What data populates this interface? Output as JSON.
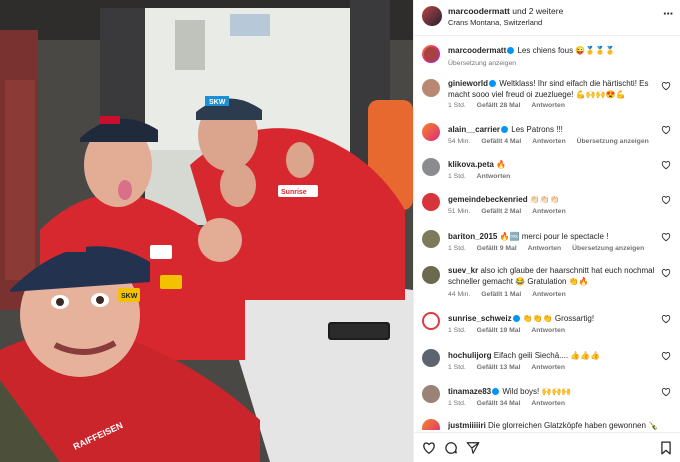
{
  "header": {
    "username": "marcoodermatt",
    "and_more": "und 2 weitere",
    "location": "Crans Montana, Switzerland"
  },
  "icons": {
    "more": "more-options-icon",
    "like": "heart-icon",
    "comment": "comment-icon",
    "share": "send-icon",
    "save": "bookmark-icon"
  },
  "caption": {
    "user": "marcoodermatt",
    "text": "Les chiens fous 😜🥇🥇🥇",
    "translate": "Übersetzung anzeigen"
  },
  "comments": [
    {
      "user": "ginieworld",
      "verified": true,
      "text": "Weltklass! Ihr sind eifach die härtischti! Es macht sooo viel freud oi zuezluege! 💪🙌🙌😍💪",
      "time": "1 Std.",
      "likes": "Gefällt 28 Mal",
      "reply": "Antworten",
      "translate": ""
    },
    {
      "user": "alain__carrier",
      "verified": true,
      "text": "Les Patrons !!!",
      "time": "54 Min.",
      "likes": "Gefällt 4 Mal",
      "reply": "Antworten",
      "translate": "Übersetzung anzeigen"
    },
    {
      "user": "klikova.peta",
      "verified": false,
      "text": "🔥",
      "time": "1 Std.",
      "likes": "",
      "reply": "Antworten",
      "translate": ""
    },
    {
      "user": "gemeindebeckenried",
      "verified": false,
      "text": "👏🏻👏🏻👏🏻",
      "time": "51 Min.",
      "likes": "Gefällt 2 Mal",
      "reply": "Antworten",
      "translate": ""
    },
    {
      "user": "bariton_2015",
      "verified": false,
      "text": "🔥🆒 merci pour le spectacle !",
      "time": "1 Std.",
      "likes": "Gefällt 9 Mal",
      "reply": "Antworten",
      "translate": "Übersetzung anzeigen"
    },
    {
      "user": "suev_kr",
      "verified": false,
      "text": "also ich glaube der haarschnitt hat euch nochmal schneller gemacht 😂 Gratulation 👏🔥",
      "time": "44 Min.",
      "likes": "Gefällt 1 Mal",
      "reply": "Antworten",
      "translate": ""
    },
    {
      "user": "sunrise_schweiz",
      "verified": true,
      "text": "👏👏👏 Grossartig!",
      "time": "1 Std.",
      "likes": "Gefällt 19 Mal",
      "reply": "Antworten",
      "translate": ""
    },
    {
      "user": "hochulijorg",
      "verified": false,
      "text": "Eifach geili Siechä.... 👍👍👍",
      "time": "1 Std.",
      "likes": "Gefällt 13 Mal",
      "reply": "Antworten",
      "translate": ""
    },
    {
      "user": "tinamaze83",
      "verified": true,
      "text": "Wild boys! 🙌🙌🙌",
      "time": "1 Std.",
      "likes": "Gefällt 34 Mal",
      "reply": "Antworten",
      "translate": ""
    },
    {
      "user": "justmiiiiiri",
      "verified": false,
      "text": "Die glorreichen Glatzköpfe haben gewonnen 🍾",
      "time": "",
      "likes": "",
      "reply": "",
      "translate": ""
    }
  ],
  "photo": {
    "brand1": "SKW",
    "brand2": "Sunrise",
    "brand3": "RAIFFEISEN"
  }
}
